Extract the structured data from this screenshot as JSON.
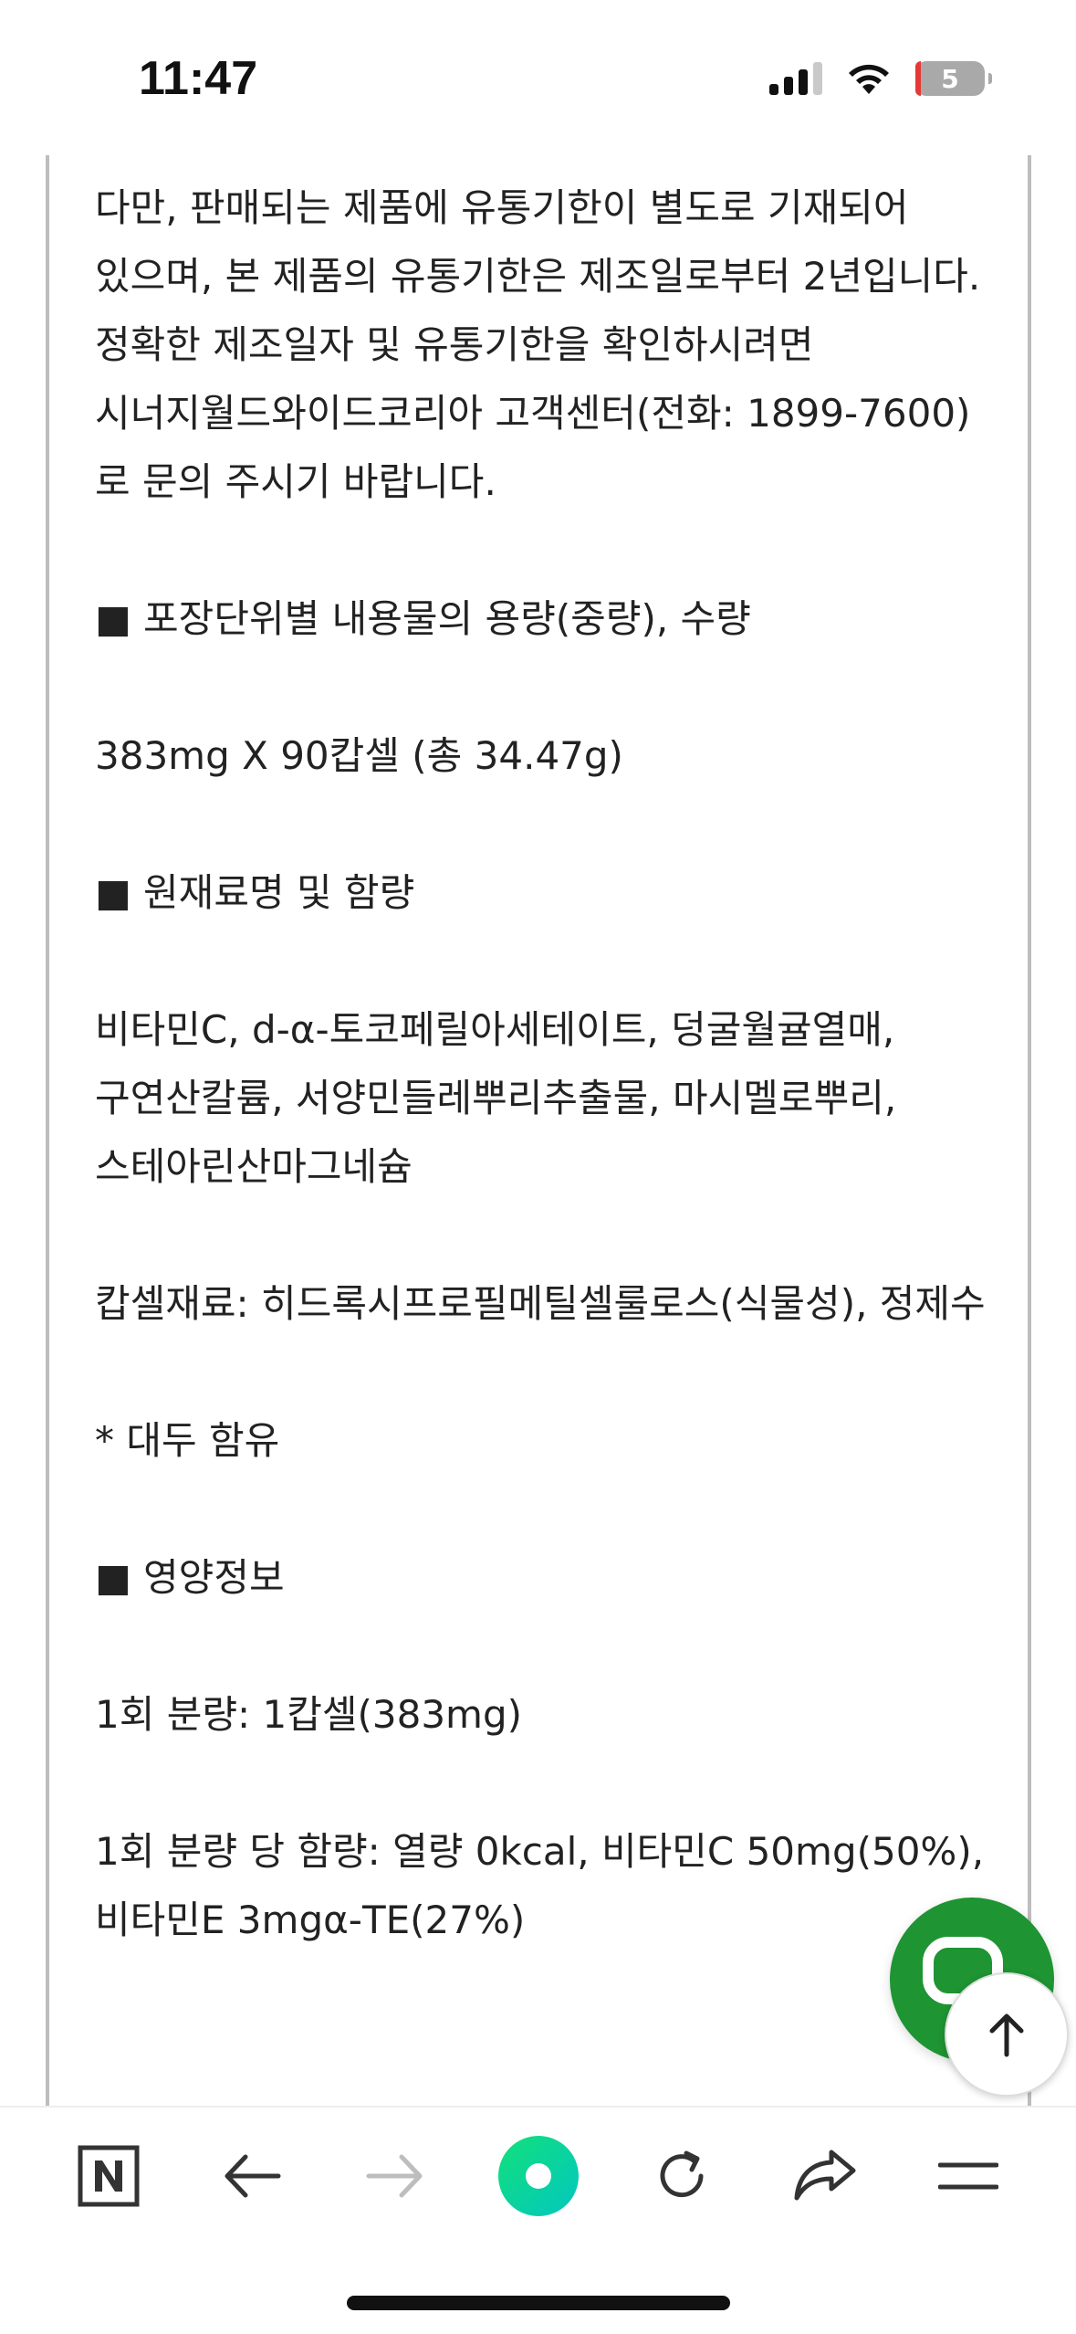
{
  "status_bar": {
    "time": "11:47",
    "battery_level": "5",
    "icons": [
      "cellular-signal-icon",
      "wifi-icon",
      "battery-icon"
    ]
  },
  "content": {
    "paragraphs": [
      "다만, 판매되는 제품에 유통기한이 별도로 기재되어 있으며, 본 제품의 유통기한은 제조일로부터 2년입니다. 정확한 제조일자 및 유통기한을 확인하시려면 시너지월드와이드코리아 고객센터(전화: 1899-7600)로 문의 주시기 바랍니다.",
      "■ 포장단위별 내용물의 용량(중량), 수량",
      "383mg X 90캅셀 (총 34.47g)",
      "■ 원재료명 및 함량",
      "비타민C, d-α-토코페릴아세테이트, 덩굴월귤열매, 구연산칼륨, 서양민들레뿌리추출물, 마시멜로뿌리, 스테아린산마그네슘",
      "캅셀재료: 히드록시프로필메틸셀룰로스(식물성), 정제수",
      "* 대두 함유",
      "■ 영양정보",
      "1회 분량: 1캅셀(383mg)",
      "1회 분량 당 함량: 열량 0kcal, 비타민C 50mg(50%), 비타민E 3mgα-TE(27%)"
    ]
  },
  "floating": {
    "chat_button": "chat-icon",
    "scroll_top_button": "arrow-up-icon"
  },
  "bottom_nav": {
    "items": [
      "naver-n-icon",
      "back-arrow-icon",
      "forward-arrow-icon",
      "green-dot-icon",
      "reload-icon",
      "share-icon",
      "menu-icon"
    ],
    "accent_color": "#1e9432"
  }
}
